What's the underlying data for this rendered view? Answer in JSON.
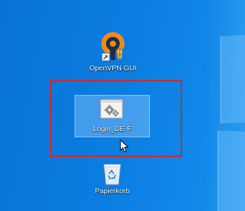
{
  "desktop": {
    "icons": [
      {
        "label": "OpenVPN GUI",
        "icon": "openvpn-icon"
      },
      {
        "label": "Login_DE-F",
        "icon": "settings-gears-icon",
        "selected": true
      },
      {
        "label": "Papierkorb",
        "icon": "recycle-bin-icon"
      }
    ]
  },
  "annotation": {
    "color": "#d0272d"
  },
  "colors": {
    "wallpaper": "#0b7ce0",
    "openvpn_orange": "#f08a1b",
    "openvpn_navy": "#1e2d4f"
  }
}
